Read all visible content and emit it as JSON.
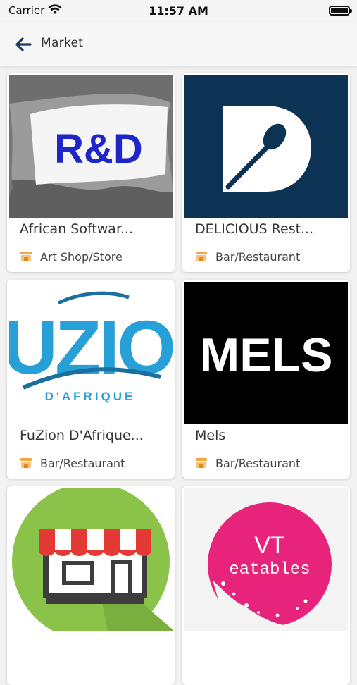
{
  "status_bar": {
    "carrier": "Carrier",
    "time": "11:57 AM"
  },
  "nav": {
    "title": "Market",
    "back_icon": "arrow-left-icon"
  },
  "listings": [
    {
      "name": "African Softwar...",
      "category": "Art Shop/Store",
      "logo_text": "R&D"
    },
    {
      "name": "DELICIOUS Rest...",
      "category": "Bar/Restaurant"
    },
    {
      "name": "FuZion D'Afrique...",
      "category": "Bar/Restaurant",
      "logo_text": "UZIO",
      "logo_subtext": "D'AFRIQUE"
    },
    {
      "name": "Mels",
      "category": "Bar/Restaurant",
      "logo_text": "MELS"
    },
    {
      "name": "",
      "category": ""
    },
    {
      "name": "",
      "category": "",
      "logo_text_line1": "VT",
      "logo_text_line2": "eatables"
    }
  ],
  "colors": {
    "category_icon": "#f4a646",
    "delicious_bg": "#0c3354",
    "rd_text": "#1f26c8",
    "fuzion_blue": "#27a0d8",
    "vt_pink": "#e8237b",
    "store_green": "#8bc34a"
  }
}
